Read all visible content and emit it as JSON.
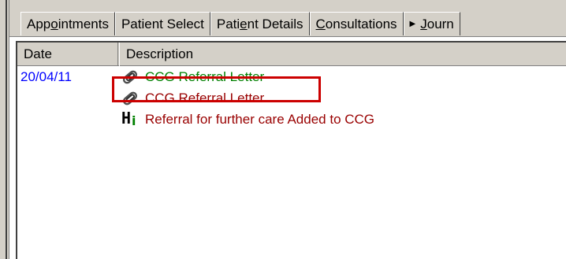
{
  "tabs": [
    {
      "pre": "App",
      "u": "o",
      "post": "intments"
    },
    {
      "pre": "Patient Select",
      "u": "",
      "post": ""
    },
    {
      "pre": "Pati",
      "u": "e",
      "post": "nt Details"
    },
    {
      "pre": "",
      "u": "C",
      "post": "onsultations"
    },
    {
      "pre": "",
      "u": "J",
      "post": "ourn",
      "arrow": "▶"
    }
  ],
  "list": {
    "columns": {
      "date": "Date",
      "description": "Description"
    },
    "rows": [
      {
        "date": "20/04/11",
        "icon": "paperclip-icon",
        "text": "CCG Referral Letter",
        "color": "#008000"
      },
      {
        "date": "",
        "icon": "paperclip-icon",
        "text": "CCG Referral Letter",
        "color": "#990000"
      },
      {
        "date": "",
        "icon": "history-info-icon",
        "icon_text": {
          "h": "H",
          "i": "i"
        },
        "text": "Referral for further care Added to  CCG",
        "color": "#990000"
      }
    ]
  },
  "highlight_color": "#cc0000"
}
